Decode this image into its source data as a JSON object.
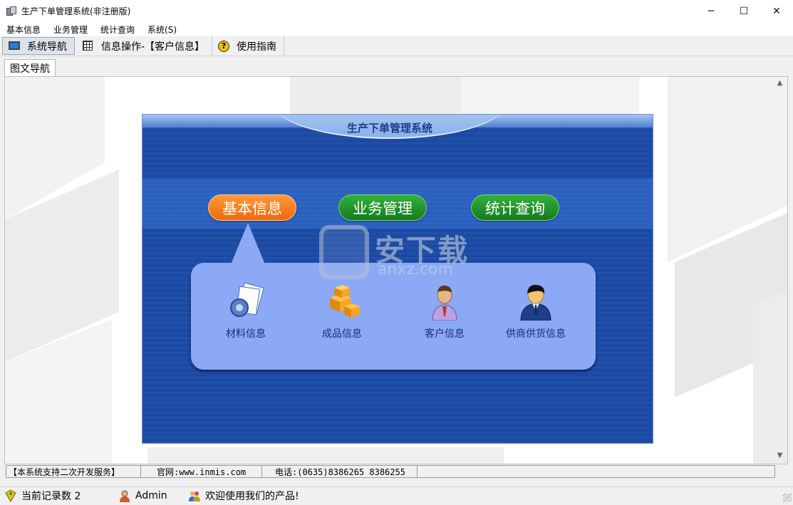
{
  "window": {
    "title": "生产下单管理系统(非注册版)",
    "controls": {
      "minimize": "─",
      "maximize": "☐",
      "close": "✕"
    }
  },
  "menu": [
    "基本信息",
    "业务管理",
    "统计查询",
    "系统(S)"
  ],
  "toolbar": {
    "tabs": [
      {
        "label": "系统导航",
        "icon": "monitor-icon",
        "active": true
      },
      {
        "label": "信息操作-【客户信息】",
        "icon": "grid-icon",
        "active": false
      },
      {
        "label": "使用指南",
        "icon": "help-icon",
        "active": false
      }
    ]
  },
  "subtab": {
    "label": "图文导航"
  },
  "panel": {
    "title": "生产下单管理系统",
    "pills": [
      {
        "label": "基本信息",
        "color": "#f0690c",
        "selected": true
      },
      {
        "label": "业务管理",
        "color": "#167a1f",
        "selected": false
      },
      {
        "label": "统计查询",
        "color": "#167a1f",
        "selected": false
      }
    ],
    "features": [
      {
        "label": "材料信息",
        "icon": "material-icon"
      },
      {
        "label": "成品信息",
        "icon": "product-boxes-icon"
      },
      {
        "label": "客户信息",
        "icon": "customer-icon"
      },
      {
        "label": "供商供货信息",
        "icon": "supplier-icon"
      }
    ],
    "watermark": {
      "text": "安下载",
      "sub": "anxz.com"
    }
  },
  "infobar": {
    "service": "【本系统支持二次开发服务】",
    "website": "官网:www.inmis.com",
    "phone": "电话:(0635)8386265 8386255"
  },
  "statusbar": {
    "records": "当前记录数 2",
    "user": "Admin",
    "welcome": "欢迎使用我们的产品!"
  }
}
